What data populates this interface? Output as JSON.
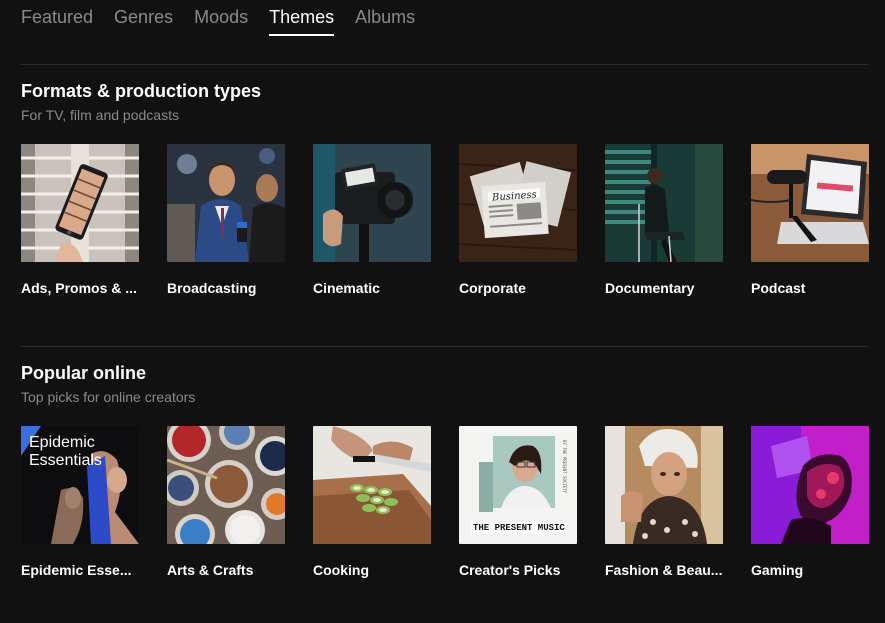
{
  "tabs": [
    {
      "label": "Featured",
      "active": false
    },
    {
      "label": "Genres",
      "active": false
    },
    {
      "label": "Moods",
      "active": false
    },
    {
      "label": "Themes",
      "active": true
    },
    {
      "label": "Albums",
      "active": false
    }
  ],
  "sections": [
    {
      "title": "Formats & production types",
      "subtitle": "For TV, film and podcasts",
      "cards": [
        {
          "label": "Ads, Promos & ...",
          "thumb": "phone-in-atrium-image"
        },
        {
          "label": "Broadcasting",
          "thumb": "men-in-suits-image"
        },
        {
          "label": "Cinematic",
          "thumb": "film-camera-image"
        },
        {
          "label": "Corporate",
          "thumb": "business-newspaper-image"
        },
        {
          "label": "Documentary",
          "thumb": "woman-by-blinds-image"
        },
        {
          "label": "Podcast",
          "thumb": "microphone-laptop-image"
        }
      ]
    },
    {
      "title": "Popular online",
      "subtitle": "Top picks for online creators",
      "cards": [
        {
          "label": "Epidemic Esse...",
          "thumb": "epidemic-essentials-cover",
          "overlay": "Epidemic Essentials"
        },
        {
          "label": "Arts & Crafts",
          "thumb": "paint-cups-image"
        },
        {
          "label": "Cooking",
          "thumb": "chopping-vegetables-image"
        },
        {
          "label": "Creator's Picks",
          "thumb": "present-music-cover",
          "overlay": "THE PRESENT MUSIC"
        },
        {
          "label": "Fashion & Beau...",
          "thumb": "woman-makeup-image"
        },
        {
          "label": "Gaming",
          "thumb": "vr-headset-neon-image"
        }
      ]
    }
  ]
}
